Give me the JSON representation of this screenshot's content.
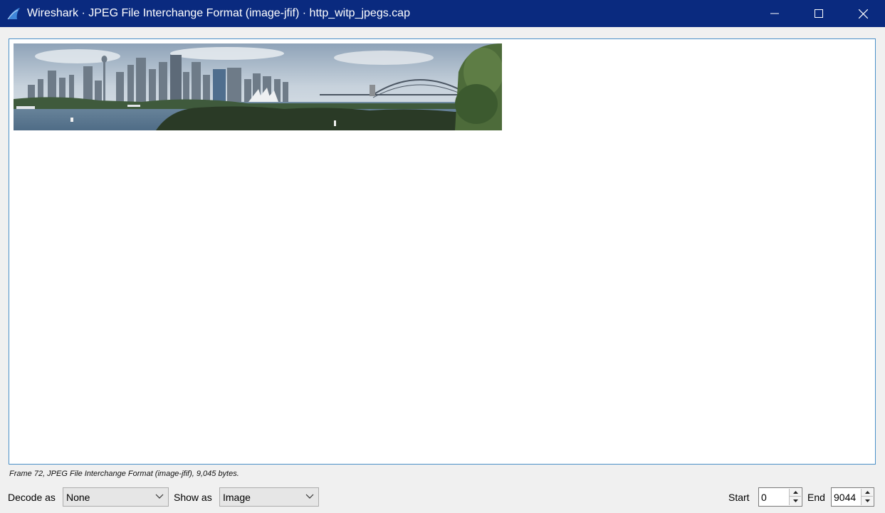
{
  "window": {
    "title": "Wireshark · JPEG File Interchange Format (image-jfif) · http_witp_jpegs.cap",
    "icon": "wireshark-fin-icon",
    "controls": [
      "minimize-icon",
      "maximize-icon",
      "close-icon"
    ]
  },
  "viewer": {
    "image_description_icon": "sydney-harbour-panorama-image"
  },
  "status": {
    "text": "Frame 72, JPEG File Interchange Format (image-jfif), 9,045 bytes."
  },
  "controls": {
    "decode_as_label": "Decode as",
    "decode_as_value": "None",
    "show_as_label": "Show as",
    "show_as_value": "Image",
    "start_label": "Start",
    "start_value": "0",
    "end_label": "End",
    "end_value": "9044"
  },
  "colors": {
    "titlebar": "#0a2a7f",
    "frame_border": "#4a90c8",
    "background": "#f0f0f0"
  }
}
